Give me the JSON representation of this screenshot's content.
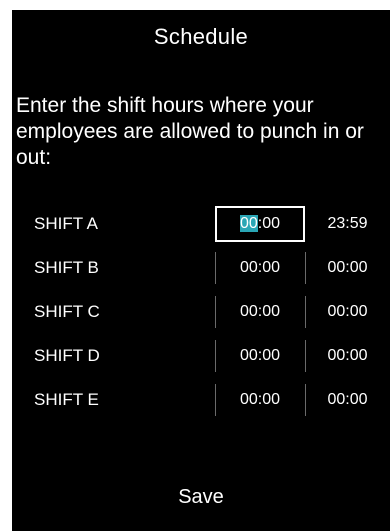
{
  "screen": {
    "title": "Schedule",
    "instructions": "Enter the shift hours where your employees are allowed to punch in or out:"
  },
  "shifts": [
    {
      "label": "SHIFT A",
      "start_hl": "00",
      "start_rest": ":00",
      "end": "23:59"
    },
    {
      "label": "SHIFT B",
      "start": "00:00",
      "end": "00:00"
    },
    {
      "label": "SHIFT C",
      "start": "00:00",
      "end": "00:00"
    },
    {
      "label": "SHIFT D",
      "start": "00:00",
      "end": "00:00"
    },
    {
      "label": "SHIFT E",
      "start": "00:00",
      "end": "00:00"
    }
  ],
  "actions": {
    "save_label": "Save"
  }
}
